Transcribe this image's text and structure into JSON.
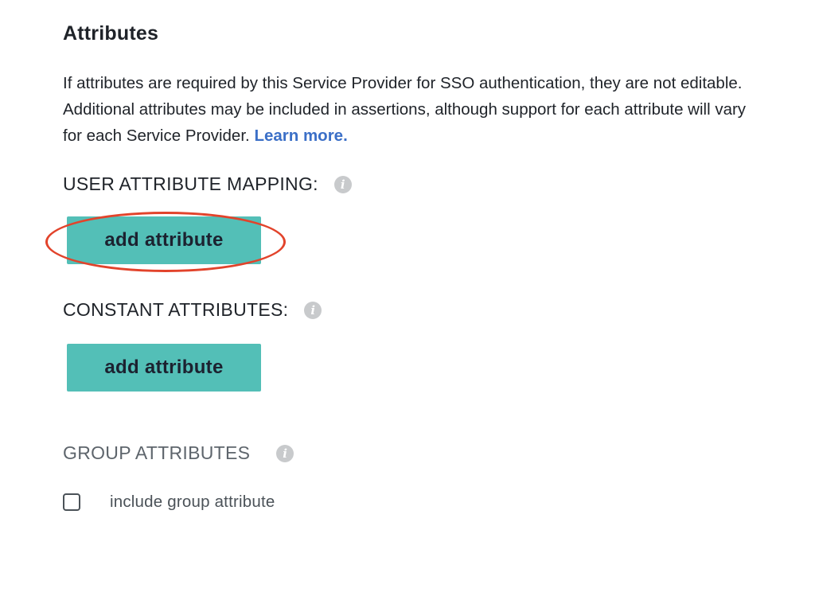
{
  "section": {
    "title": "Attributes",
    "description": "If attributes are required by this Service Provider for SSO authentication, they are not editable. Additional attributes may be included in assertions, although support for each attribute will vary for each Service Provider.",
    "learn_more_label": "Learn more."
  },
  "user_attribute_mapping": {
    "label": "USER ATTRIBUTE MAPPING:",
    "info_icon": "info-icon",
    "button_label": "add attribute"
  },
  "constant_attributes": {
    "label": "CONSTANT ATTRIBUTES:",
    "info_icon": "info-icon",
    "button_label": "add attribute"
  },
  "group_attributes": {
    "label": "GROUP ATTRIBUTES",
    "info_icon": "info-icon",
    "checkbox_label": "include group attribute",
    "checkbox_checked": false
  },
  "colors": {
    "button_bg": "#53bfb7",
    "link": "#3b6fc7",
    "highlight_ring": "#e2432b"
  }
}
